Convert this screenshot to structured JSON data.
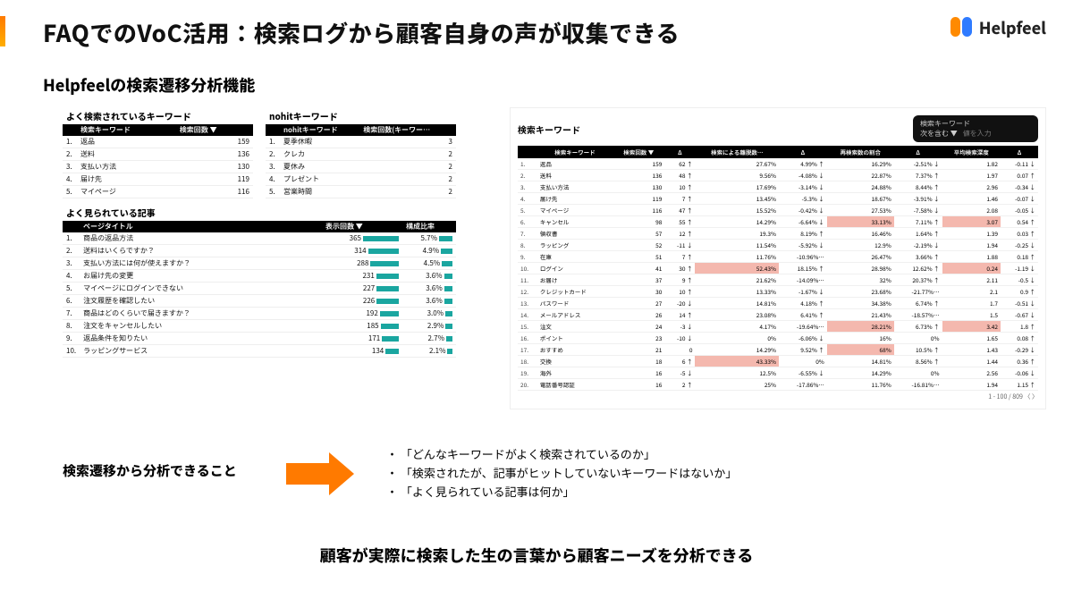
{
  "header": {
    "title": "FAQでのVoC活用：検索ログから顧客自身の声が収集できる",
    "brand": "Helpfeel"
  },
  "subtitle": "Helpfeelの検索遷移分析機能",
  "left": {
    "keywords_title": "よく検索されているキーワード",
    "keywords_cols": [
      "検索キーワード",
      "検索回数 ▼"
    ],
    "keywords": [
      {
        "rank": "1.",
        "kw": "返品",
        "n": "159"
      },
      {
        "rank": "2.",
        "kw": "送料",
        "n": "136"
      },
      {
        "rank": "3.",
        "kw": "支払い方法",
        "n": "130"
      },
      {
        "rank": "4.",
        "kw": "届け先",
        "n": "119"
      },
      {
        "rank": "5.",
        "kw": "マイページ",
        "n": "116"
      }
    ],
    "nohit_title": "nohitキーワード",
    "nohit_cols": [
      "nohitキーワード",
      "検索回数(キーワー…"
    ],
    "nohit": [
      {
        "rank": "1.",
        "kw": "夏季休暇",
        "n": "3"
      },
      {
        "rank": "2.",
        "kw": "クレカ",
        "n": "2"
      },
      {
        "rank": "3.",
        "kw": "夏休み",
        "n": "2"
      },
      {
        "rank": "4.",
        "kw": "プレゼント",
        "n": "2"
      },
      {
        "rank": "5.",
        "kw": "営業時間",
        "n": "2"
      }
    ],
    "articles_title": "よく見られている記事",
    "articles_cols": [
      "ページタイトル",
      "表示回数 ▼",
      "構成比率"
    ],
    "articles": [
      {
        "rank": "1.",
        "t": "商品の返品方法",
        "v": "365",
        "bar": 100,
        "r": "5.7%"
      },
      {
        "rank": "2.",
        "t": "送料はいくらですか？",
        "v": "314",
        "bar": 86,
        "r": "4.9%"
      },
      {
        "rank": "3.",
        "t": "支払い方法には何が使えますか？",
        "v": "288",
        "bar": 79,
        "r": "4.5%"
      },
      {
        "rank": "4.",
        "t": "お届け先の変更",
        "v": "231",
        "bar": 63,
        "r": "3.6%"
      },
      {
        "rank": "5.",
        "t": "マイページにログインできない",
        "v": "227",
        "bar": 62,
        "r": "3.6%"
      },
      {
        "rank": "6.",
        "t": "注文履歴を確認したい",
        "v": "226",
        "bar": 62,
        "r": "3.6%"
      },
      {
        "rank": "7.",
        "t": "商品はどのくらいで届きますか？",
        "v": "192",
        "bar": 53,
        "r": "3.0%"
      },
      {
        "rank": "8.",
        "t": "注文をキャンセルしたい",
        "v": "185",
        "bar": 51,
        "r": "2.9%"
      },
      {
        "rank": "9.",
        "t": "返品条件を知りたい",
        "v": "171",
        "bar": 47,
        "r": "2.7%"
      },
      {
        "rank": "10.",
        "t": "ラッピングサービス",
        "v": "134",
        "bar": 37,
        "r": "2.1%"
      }
    ]
  },
  "right": {
    "title": "検索キーワード",
    "filter_label": "検索キーワード",
    "filter_cond": "次を含む ▼",
    "filter_placeholder": "値を入力",
    "cols": [
      "",
      "検索キーワード",
      "検索回数 ▼",
      "Δ",
      "検索による離脱数…",
      "Δ",
      "再検索数の割合",
      "Δ",
      "平均検索深度",
      "Δ"
    ],
    "rows": [
      {
        "i": "1.",
        "kw": "返品",
        "c": "159",
        "cd": "62 ↑",
        "rate": "27.67%",
        "rd": "4.99% ↑",
        "re": "16.29%",
        "red": "-2.51% ↓",
        "dep": "1.82",
        "dd": "-0.11 ↓"
      },
      {
        "i": "2.",
        "kw": "送料",
        "c": "136",
        "cd": "48 ↑",
        "rate": "9.56%",
        "rd": "-4.08% ↓",
        "re": "22.87%",
        "red": "7.37% ↑",
        "dep": "1.97",
        "dd": "0.07 ↑"
      },
      {
        "i": "3.",
        "kw": "支払い方法",
        "c": "130",
        "cd": "10 ↑",
        "rate": "17.69%",
        "rd": "-3.14% ↓",
        "re": "24.88%",
        "red": "8.44% ↑",
        "dep": "2.96",
        "dd": "-0.34 ↓"
      },
      {
        "i": "4.",
        "kw": "届け先",
        "c": "119",
        "cd": "7 ↑",
        "rate": "13.45%",
        "rd": "-5.3% ↓",
        "re": "18.67%",
        "red": "-3.91% ↓",
        "dep": "1.46",
        "dd": "-0.07 ↓"
      },
      {
        "i": "5.",
        "kw": "マイページ",
        "c": "116",
        "cd": "47 ↑",
        "rate": "15.52%",
        "rd": "-0.42% ↓",
        "re": "27.53%",
        "red": "-7.58% ↓",
        "dep": "2.08",
        "dd": "-0.05 ↓"
      },
      {
        "i": "6.",
        "kw": "キャンセル",
        "c": "98",
        "cd": "55 ↑",
        "rate": "14.29%",
        "rd": "-6.64% ↓",
        "re": "33.13%",
        "red": "7.11% ↑",
        "dep": "3.07",
        "dd": "0.54 ↑",
        "hl": "y"
      },
      {
        "i": "7.",
        "kw": "領収書",
        "c": "57",
        "cd": "12 ↑",
        "rate": "19.3%",
        "rd": "8.19% ↑",
        "re": "16.46%",
        "red": "1.64% ↑",
        "dep": "1.39",
        "dd": "0.03 ↑"
      },
      {
        "i": "8.",
        "kw": "ラッピング",
        "c": "52",
        "cd": "-11 ↓",
        "rate": "11.54%",
        "rd": "-5.92% ↓",
        "re": "12.9%",
        "red": "-2.19% ↓",
        "dep": "1.94",
        "dd": "-0.25 ↓"
      },
      {
        "i": "9.",
        "kw": "在庫",
        "c": "51",
        "cd": "7 ↑",
        "rate": "11.76%",
        "rd": "-10.96%…",
        "re": "26.47%",
        "red": "3.66% ↑",
        "dep": "1.88",
        "dd": "0.18 ↑"
      },
      {
        "i": "10.",
        "kw": "ログイン",
        "c": "41",
        "cd": "30 ↑",
        "rate": "52.43%",
        "rd": "18.15% ↑",
        "re": "28.98%",
        "red": "12.62% ↑",
        "dep": "0.24",
        "dd": "-1.19 ↓",
        "hl": "r"
      },
      {
        "i": "11.",
        "kw": "お届け",
        "c": "37",
        "cd": "9 ↑",
        "rate": "21.62%",
        "rd": "-14.09%…",
        "re": "32%",
        "red": "20.37% ↑",
        "dep": "2.11",
        "dd": "-0.5 ↓"
      },
      {
        "i": "12.",
        "kw": "クレジットカード",
        "c": "30",
        "cd": "10 ↑",
        "rate": "13.33%",
        "rd": "-1.67% ↓",
        "re": "23.68%",
        "red": "-21.77%…",
        "dep": "2.1",
        "dd": "0.9 ↑"
      },
      {
        "i": "13.",
        "kw": "パスワード",
        "c": "27",
        "cd": "-20 ↓",
        "rate": "14.81%",
        "rd": "4.18% ↑",
        "re": "34.38%",
        "red": "6.74% ↑",
        "dep": "1.7",
        "dd": "-0.51 ↓"
      },
      {
        "i": "14.",
        "kw": "メールアドレス",
        "c": "26",
        "cd": "14 ↑",
        "rate": "23.08%",
        "rd": "6.41% ↑",
        "re": "21.43%",
        "red": "-18.57%…",
        "dep": "1.5",
        "dd": "-0.67 ↓"
      },
      {
        "i": "15.",
        "kw": "注文",
        "c": "24",
        "cd": "-3 ↓",
        "rate": "4.17%",
        "rd": "-19.64%…",
        "re": "28.21%",
        "red": "6.73% ↑",
        "dep": "3.42",
        "dd": "1.8 ↑",
        "hl": "y"
      },
      {
        "i": "16.",
        "kw": "ポイント",
        "c": "23",
        "cd": "-10 ↓",
        "rate": "0%",
        "rd": "-6.06% ↓",
        "re": "16%",
        "red": "0%",
        "dep": "1.65",
        "dd": "0.08 ↑"
      },
      {
        "i": "17.",
        "kw": "おすすめ",
        "c": "21",
        "cd": "0",
        "rate": "14.29%",
        "rd": "9.52% ↑",
        "re": "68%",
        "red": "10.5% ↑",
        "dep": "1.43",
        "dd": "-0.29 ↓",
        "hl": "r2"
      },
      {
        "i": "18.",
        "kw": "交換",
        "c": "18",
        "cd": "6 ↑",
        "rate": "43.33%",
        "rd": "0%",
        "re": "14.81%",
        "red": "8.56% ↑",
        "dep": "1.44",
        "dd": "0.36 ↑",
        "hl": "r3"
      },
      {
        "i": "19.",
        "kw": "海外",
        "c": "16",
        "cd": "-5 ↓",
        "rate": "12.5%",
        "rd": "-6.55% ↓",
        "re": "14.29%",
        "red": "0%",
        "dep": "2.56",
        "dd": "-0.06 ↓"
      },
      {
        "i": "20.",
        "kw": "電話番号認証",
        "c": "16",
        "cd": "2 ↑",
        "rate": "25%",
        "rd": "-17.86%…",
        "re": "11.76%",
        "red": "-16.81%…",
        "dep": "1.94",
        "dd": "1.15 ↑"
      }
    ],
    "pager_text": "1 - 100 / 809  〈 〉"
  },
  "callout": "検索遷移から分析できること",
  "bullets": [
    "「どんなキーワードがよく検索されているのか」",
    "「検索されたが、記事がヒットしていないキーワードはないか」",
    "「よく見られている記事は何か」"
  ],
  "conclusion": "顧客が実際に検索した生の言葉から顧客ニーズを分析できる"
}
